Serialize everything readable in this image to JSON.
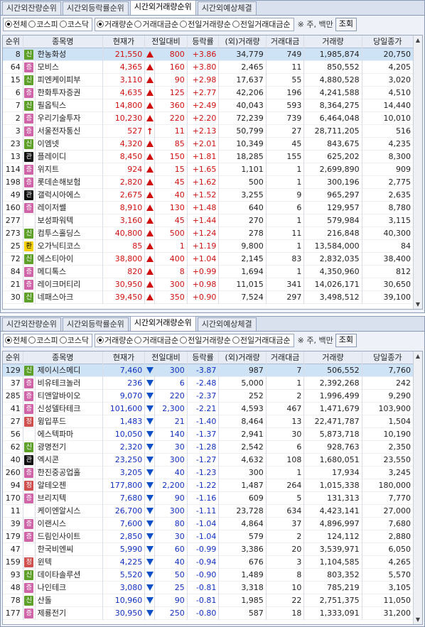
{
  "panel1": {
    "tabs": [
      "시간외잔량순위",
      "시간외등락률순위",
      "시간외거래량순위",
      "시간외예상체결"
    ],
    "active_tab": 2,
    "market_options": [
      "전체",
      "코스피",
      "코스닥"
    ],
    "market_selected": 0,
    "sort_options": [
      "거래량순",
      "거래대금순",
      "전일거래량순",
      "전일거래대금순"
    ],
    "sort_selected": 0,
    "note": "※ 주, 백만",
    "query_button": "조회",
    "headers": [
      "순위",
      "종목명",
      "현재가",
      "전일대비",
      "등락률",
      "(외)거래량",
      "거래대금",
      "거래량",
      "당일종가"
    ],
    "rows": [
      {
        "rank": "8",
        "badge": "신",
        "name": "한농화성",
        "price": "21,550",
        "arrow": "up",
        "chg": "800",
        "rate": "+3.86",
        "ovol": "34,779",
        "amt": "749",
        "vol": "1,985,874",
        "close": "20,750",
        "sel": true
      },
      {
        "rank": "64",
        "badge": "증",
        "name": "모비스",
        "price": "4,365",
        "arrow": "up",
        "chg": "160",
        "rate": "+3.80",
        "ovol": "2,465",
        "amt": "11",
        "vol": "850,552",
        "close": "4,205"
      },
      {
        "rank": "15",
        "badge": "신",
        "name": "피엔케이피부",
        "price": "3,110",
        "arrow": "up",
        "chg": "90",
        "rate": "+2.98",
        "ovol": "17,637",
        "amt": "55",
        "vol": "4,880,528",
        "close": "3,020"
      },
      {
        "rank": "6",
        "badge": "증",
        "name": "한화투자증권",
        "price": "4,635",
        "arrow": "up",
        "chg": "125",
        "rate": "+2.77",
        "ovol": "42,206",
        "amt": "196",
        "vol": "4,241,588",
        "close": "4,510"
      },
      {
        "rank": "7",
        "badge": "신",
        "name": "필옵틱스",
        "price": "14,800",
        "arrow": "up",
        "chg": "360",
        "rate": "+2.49",
        "ovol": "40,043",
        "amt": "593",
        "vol": "8,364,275",
        "close": "14,440"
      },
      {
        "rank": "2",
        "badge": "증",
        "name": "우리기술투자",
        "price": "10,230",
        "arrow": "up",
        "chg": "220",
        "rate": "+2.20",
        "ovol": "72,239",
        "amt": "739",
        "vol": "6,464,048",
        "close": "10,010"
      },
      {
        "rank": "3",
        "badge": "증",
        "name": "서울전자통신",
        "price": "527",
        "arrow": "upper",
        "chg": "11",
        "rate": "+2.13",
        "ovol": "50,799",
        "amt": "27",
        "vol": "28,711,205",
        "close": "516"
      },
      {
        "rank": "23",
        "badge": "신",
        "name": "이엠넷",
        "price": "4,320",
        "arrow": "up",
        "chg": "85",
        "rate": "+2.01",
        "ovol": "10,349",
        "amt": "45",
        "vol": "843,675",
        "close": "4,235"
      },
      {
        "rank": "13",
        "badge": "관",
        "name": "플레이디",
        "price": "8,450",
        "arrow": "up",
        "chg": "150",
        "rate": "+1.81",
        "ovol": "18,285",
        "amt": "155",
        "vol": "625,202",
        "close": "8,300"
      },
      {
        "rank": "114",
        "badge": "증",
        "name": "위지트",
        "price": "924",
        "arrow": "up",
        "chg": "15",
        "rate": "+1.65",
        "ovol": "1,101",
        "amt": "1",
        "vol": "2,699,890",
        "close": "909"
      },
      {
        "rank": "198",
        "badge": "증",
        "name": "롯데손해보험",
        "price": "2,820",
        "arrow": "up",
        "chg": "45",
        "rate": "+1.62",
        "ovol": "500",
        "amt": "1",
        "vol": "300,196",
        "close": "2,775"
      },
      {
        "rank": "49",
        "badge": "관",
        "name": "갤럭시아에스",
        "price": "2,675",
        "arrow": "up",
        "chg": "40",
        "rate": "+1.52",
        "ovol": "3,255",
        "amt": "9",
        "vol": "965,297",
        "close": "2,635"
      },
      {
        "rank": "160",
        "badge": "증",
        "name": "레이저쎌",
        "price": "8,910",
        "arrow": "up",
        "chg": "130",
        "rate": "+1.48",
        "ovol": "640",
        "amt": "6",
        "vol": "129,957",
        "close": "8,780"
      },
      {
        "rank": "277",
        "badge": "",
        "name": "보성파워텍",
        "price": "3,160",
        "arrow": "up",
        "chg": "45",
        "rate": "+1.44",
        "ovol": "270",
        "amt": "1",
        "vol": "579,984",
        "close": "3,115"
      },
      {
        "rank": "273",
        "badge": "신",
        "name": "컴투스홀딩스",
        "price": "40,800",
        "arrow": "up",
        "chg": "500",
        "rate": "+1.24",
        "ovol": "278",
        "amt": "11",
        "vol": "216,848",
        "close": "40,300"
      },
      {
        "rank": "25",
        "badge": "환",
        "name": "오가닉티코스",
        "price": "85",
        "arrow": "up",
        "chg": "1",
        "rate": "+1.19",
        "ovol": "9,800",
        "amt": "1",
        "vol": "13,584,000",
        "close": "84"
      },
      {
        "rank": "72",
        "badge": "신",
        "name": "에스티아이",
        "price": "38,800",
        "arrow": "up",
        "chg": "400",
        "rate": "+1.04",
        "ovol": "2,145",
        "amt": "83",
        "vol": "2,832,035",
        "close": "38,400"
      },
      {
        "rank": "84",
        "badge": "증",
        "name": "메디톡스",
        "price": "820",
        "arrow": "up",
        "chg": "8",
        "rate": "+0.99",
        "ovol": "1,694",
        "amt": "1",
        "vol": "4,350,960",
        "close": "812"
      },
      {
        "rank": "21",
        "badge": "증",
        "name": "레이크머티리",
        "price": "30,950",
        "arrow": "up",
        "chg": "300",
        "rate": "+0.98",
        "ovol": "11,015",
        "amt": "341",
        "vol": "14,026,171",
        "close": "30,650"
      },
      {
        "rank": "30",
        "badge": "신",
        "name": "네패스아크",
        "price": "39,450",
        "arrow": "up",
        "chg": "350",
        "rate": "+0.90",
        "ovol": "7,524",
        "amt": "297",
        "vol": "3,498,512",
        "close": "39,100"
      }
    ]
  },
  "panel2": {
    "tabs": [
      "시간외잔량순위",
      "시간외등락률순위",
      "시간외거래량순위",
      "시간외예상체결"
    ],
    "active_tab": 2,
    "market_options": [
      "전체",
      "코스피",
      "코스닥"
    ],
    "market_selected": 0,
    "sort_options": [
      "거래량순",
      "거래대금순",
      "전일거래량순",
      "전일거래대금순"
    ],
    "sort_selected": 0,
    "note": "※ 주, 백만",
    "query_button": "조회",
    "headers": [
      "순위",
      "종목명",
      "현재가",
      "전일대비",
      "등락률",
      "(외)거래량",
      "거래대금",
      "거래량",
      "당일종가"
    ],
    "rows": [
      {
        "rank": "129",
        "badge": "신",
        "name": "제이시스메디",
        "price": "7,460",
        "arrow": "dn",
        "chg": "300",
        "rate": "-3.87",
        "ovol": "987",
        "amt": "7",
        "vol": "506,552",
        "close": "7,760",
        "sel": true
      },
      {
        "rank": "37",
        "badge": "증",
        "name": "비유테크놀러",
        "price": "236",
        "arrow": "dn",
        "chg": "6",
        "rate": "-2.48",
        "ovol": "5,000",
        "amt": "1",
        "vol": "2,392,268",
        "close": "242"
      },
      {
        "rank": "285",
        "badge": "증",
        "name": "티앤알바이오",
        "price": "9,070",
        "arrow": "dn",
        "chg": "220",
        "rate": "-2.37",
        "ovol": "252",
        "amt": "2",
        "vol": "1,996,499",
        "close": "9,290"
      },
      {
        "rank": "41",
        "badge": "증",
        "name": "신성델타테크",
        "price": "101,600",
        "arrow": "dn",
        "chg": "2,300",
        "rate": "-2.21",
        "ovol": "4,593",
        "amt": "467",
        "vol": "1,471,679",
        "close": "103,900"
      },
      {
        "rank": "27",
        "badge": "정",
        "name": "윙입푸드",
        "price": "1,483",
        "arrow": "dn",
        "chg": "21",
        "rate": "-1.40",
        "ovol": "8,464",
        "amt": "13",
        "vol": "22,471,787",
        "close": "1,504"
      },
      {
        "rank": "56",
        "badge": "",
        "name": "에스텍파마",
        "price": "10,050",
        "arrow": "dn",
        "chg": "140",
        "rate": "-1.37",
        "ovol": "2,941",
        "amt": "30",
        "vol": "5,873,718",
        "close": "10,190"
      },
      {
        "rank": "62",
        "badge": "신",
        "name": "광명전기",
        "price": "2,320",
        "arrow": "dn",
        "chg": "30",
        "rate": "-1.28",
        "ovol": "2,542",
        "amt": "6",
        "vol": "928,763",
        "close": "2,350"
      },
      {
        "rank": "40",
        "badge": "관",
        "name": "엑시콘",
        "price": "23,250",
        "arrow": "dn",
        "chg": "300",
        "rate": "-1.27",
        "ovol": "4,632",
        "amt": "108",
        "vol": "1,680,051",
        "close": "23,550"
      },
      {
        "rank": "260",
        "badge": "증",
        "name": "한진중공업홀",
        "price": "3,205",
        "arrow": "dn",
        "chg": "40",
        "rate": "-1.23",
        "ovol": "300",
        "amt": "1",
        "vol": "17,934",
        "close": "3,245"
      },
      {
        "rank": "94",
        "badge": "정",
        "name": "알테오젠",
        "price": "177,800",
        "arrow": "dn",
        "chg": "2,200",
        "rate": "-1.22",
        "ovol": "1,487",
        "amt": "264",
        "vol": "1,015,338",
        "close": "180,000"
      },
      {
        "rank": "170",
        "badge": "증",
        "name": "브리지텍",
        "price": "7,680",
        "arrow": "dn",
        "chg": "90",
        "rate": "-1.16",
        "ovol": "609",
        "amt": "5",
        "vol": "131,313",
        "close": "7,770"
      },
      {
        "rank": "11",
        "badge": "",
        "name": "케이엔알시스",
        "price": "26,700",
        "arrow": "dn",
        "chg": "300",
        "rate": "-1.11",
        "ovol": "23,728",
        "amt": "634",
        "vol": "4,423,141",
        "close": "27,000"
      },
      {
        "rank": "39",
        "badge": "증",
        "name": "이랜시스",
        "price": "7,600",
        "arrow": "dn",
        "chg": "80",
        "rate": "-1.04",
        "ovol": "4,864",
        "amt": "37",
        "vol": "4,896,997",
        "close": "7,680"
      },
      {
        "rank": "179",
        "badge": "증",
        "name": "드림인사이트",
        "price": "2,850",
        "arrow": "dn",
        "chg": "30",
        "rate": "-1.04",
        "ovol": "579",
        "amt": "2",
        "vol": "124,112",
        "close": "2,880"
      },
      {
        "rank": "47",
        "badge": "",
        "name": "한국비엔씨",
        "price": "5,990",
        "arrow": "dn",
        "chg": "60",
        "rate": "-0.99",
        "ovol": "3,386",
        "amt": "20",
        "vol": "3,539,971",
        "close": "6,050"
      },
      {
        "rank": "159",
        "badge": "정",
        "name": "윈텍",
        "price": "4,225",
        "arrow": "dn",
        "chg": "40",
        "rate": "-0.94",
        "ovol": "676",
        "amt": "3",
        "vol": "1,104,585",
        "close": "4,265"
      },
      {
        "rank": "93",
        "badge": "신",
        "name": "데이타솔루션",
        "price": "5,520",
        "arrow": "dn",
        "chg": "50",
        "rate": "-0.90",
        "ovol": "1,489",
        "amt": "8",
        "vol": "803,352",
        "close": "5,570"
      },
      {
        "rank": "48",
        "badge": "증",
        "name": "나인테크",
        "price": "3,080",
        "arrow": "dn",
        "chg": "25",
        "rate": "-0.81",
        "ovol": "3,318",
        "amt": "10",
        "vol": "785,219",
        "close": "3,105"
      },
      {
        "rank": "78",
        "badge": "신",
        "name": "산돌",
        "price": "10,960",
        "arrow": "dn",
        "chg": "90",
        "rate": "-0.81",
        "ovol": "1,985",
        "amt": "22",
        "vol": "2,751,375",
        "close": "11,050"
      },
      {
        "rank": "177",
        "badge": "증",
        "name": "제룡전기",
        "price": "30,950",
        "arrow": "dn",
        "chg": "250",
        "rate": "-0.80",
        "ovol": "587",
        "amt": "18",
        "vol": "1,333,091",
        "close": "31,200"
      }
    ]
  }
}
